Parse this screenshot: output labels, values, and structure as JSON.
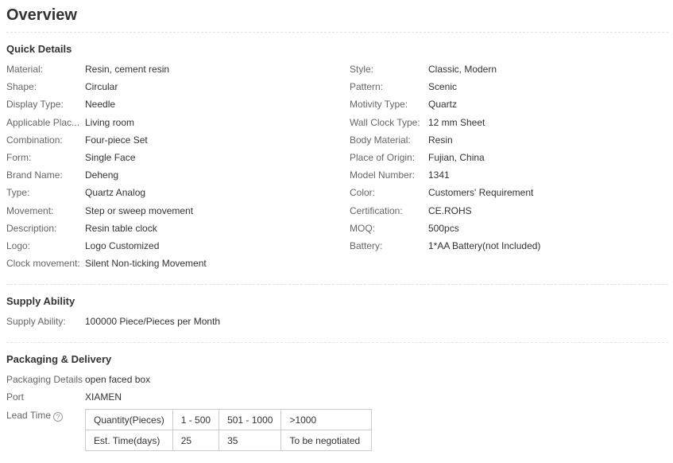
{
  "page_title": "Overview",
  "quick_details": {
    "title": "Quick Details",
    "left": [
      {
        "label": "Material:",
        "value": "Resin, cement resin"
      },
      {
        "label": "Shape:",
        "value": "Circular"
      },
      {
        "label": "Display Type:",
        "value": "Needle"
      },
      {
        "label": "Applicable Plac...",
        "value": "Living room"
      },
      {
        "label": "Combination:",
        "value": "Four-piece Set"
      },
      {
        "label": "Form:",
        "value": "Single Face"
      },
      {
        "label": "Brand Name:",
        "value": "Deheng"
      },
      {
        "label": "Type:",
        "value": "Quartz Analog"
      },
      {
        "label": "Movement:",
        "value": "Step or sweep movement"
      },
      {
        "label": "Description:",
        "value": "Resin table clock"
      },
      {
        "label": "Logo:",
        "value": "Logo Customized"
      },
      {
        "label": "Clock movement:",
        "value": "Silent Non-ticking Movement"
      }
    ],
    "right": [
      {
        "label": "Style:",
        "value": "Classic, Modern"
      },
      {
        "label": "Pattern:",
        "value": "Scenic"
      },
      {
        "label": "Motivity Type:",
        "value": "Quartz"
      },
      {
        "label": "Wall Clock Type:",
        "value": "12 mm Sheet"
      },
      {
        "label": "Body Material:",
        "value": "Resin"
      },
      {
        "label": "Place of Origin:",
        "value": "Fujian, China"
      },
      {
        "label": "Model Number:",
        "value": "1341"
      },
      {
        "label": "Color:",
        "value": "Customers' Requirement"
      },
      {
        "label": "Certification:",
        "value": "CE.ROHS"
      },
      {
        "label": "MOQ:",
        "value": "500pcs"
      },
      {
        "label": "Battery:",
        "value": "1*AA Battery(not Included)"
      }
    ]
  },
  "supply": {
    "title": "Supply Ability",
    "label": "Supply Ability:",
    "value": "100000 Piece/Pieces per Month"
  },
  "packaging": {
    "title": "Packaging & Delivery",
    "details_label": "Packaging Details",
    "details_value": "open faced box",
    "port_label": "Port",
    "port_value": "XIAMEN",
    "lead_label": "Lead Time",
    "help_glyph": "?",
    "lead_table": {
      "row1": [
        "Quantity(Pieces)",
        "1 - 500",
        "501 - 1000",
        ">1000"
      ],
      "row2": [
        "Est. Time(days)",
        "25",
        "35",
        "To be negotiated"
      ]
    }
  }
}
